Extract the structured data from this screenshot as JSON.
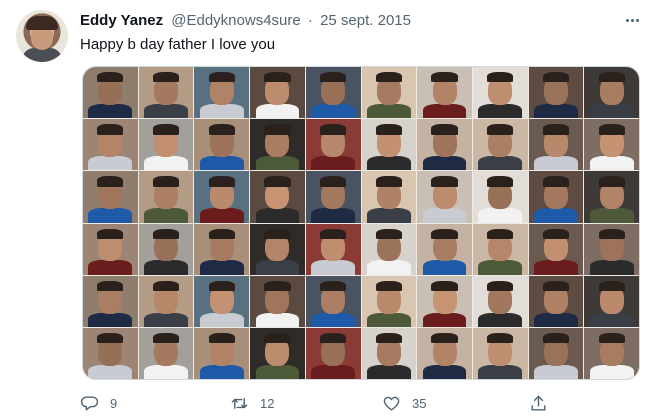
{
  "tweet": {
    "display_name": "Eddy Yanez",
    "handle": "@Eddyknows4sure",
    "separator": "·",
    "date": "25 sept. 2015",
    "text": "Happy b day father I love you",
    "media_icon": "photo-collage"
  },
  "actions": {
    "reply_count": "9",
    "retweet_count": "12",
    "like_count": "35"
  },
  "colors": {
    "text_primary": "#0f1419",
    "text_secondary": "#536471",
    "border": "#cfd9de"
  }
}
